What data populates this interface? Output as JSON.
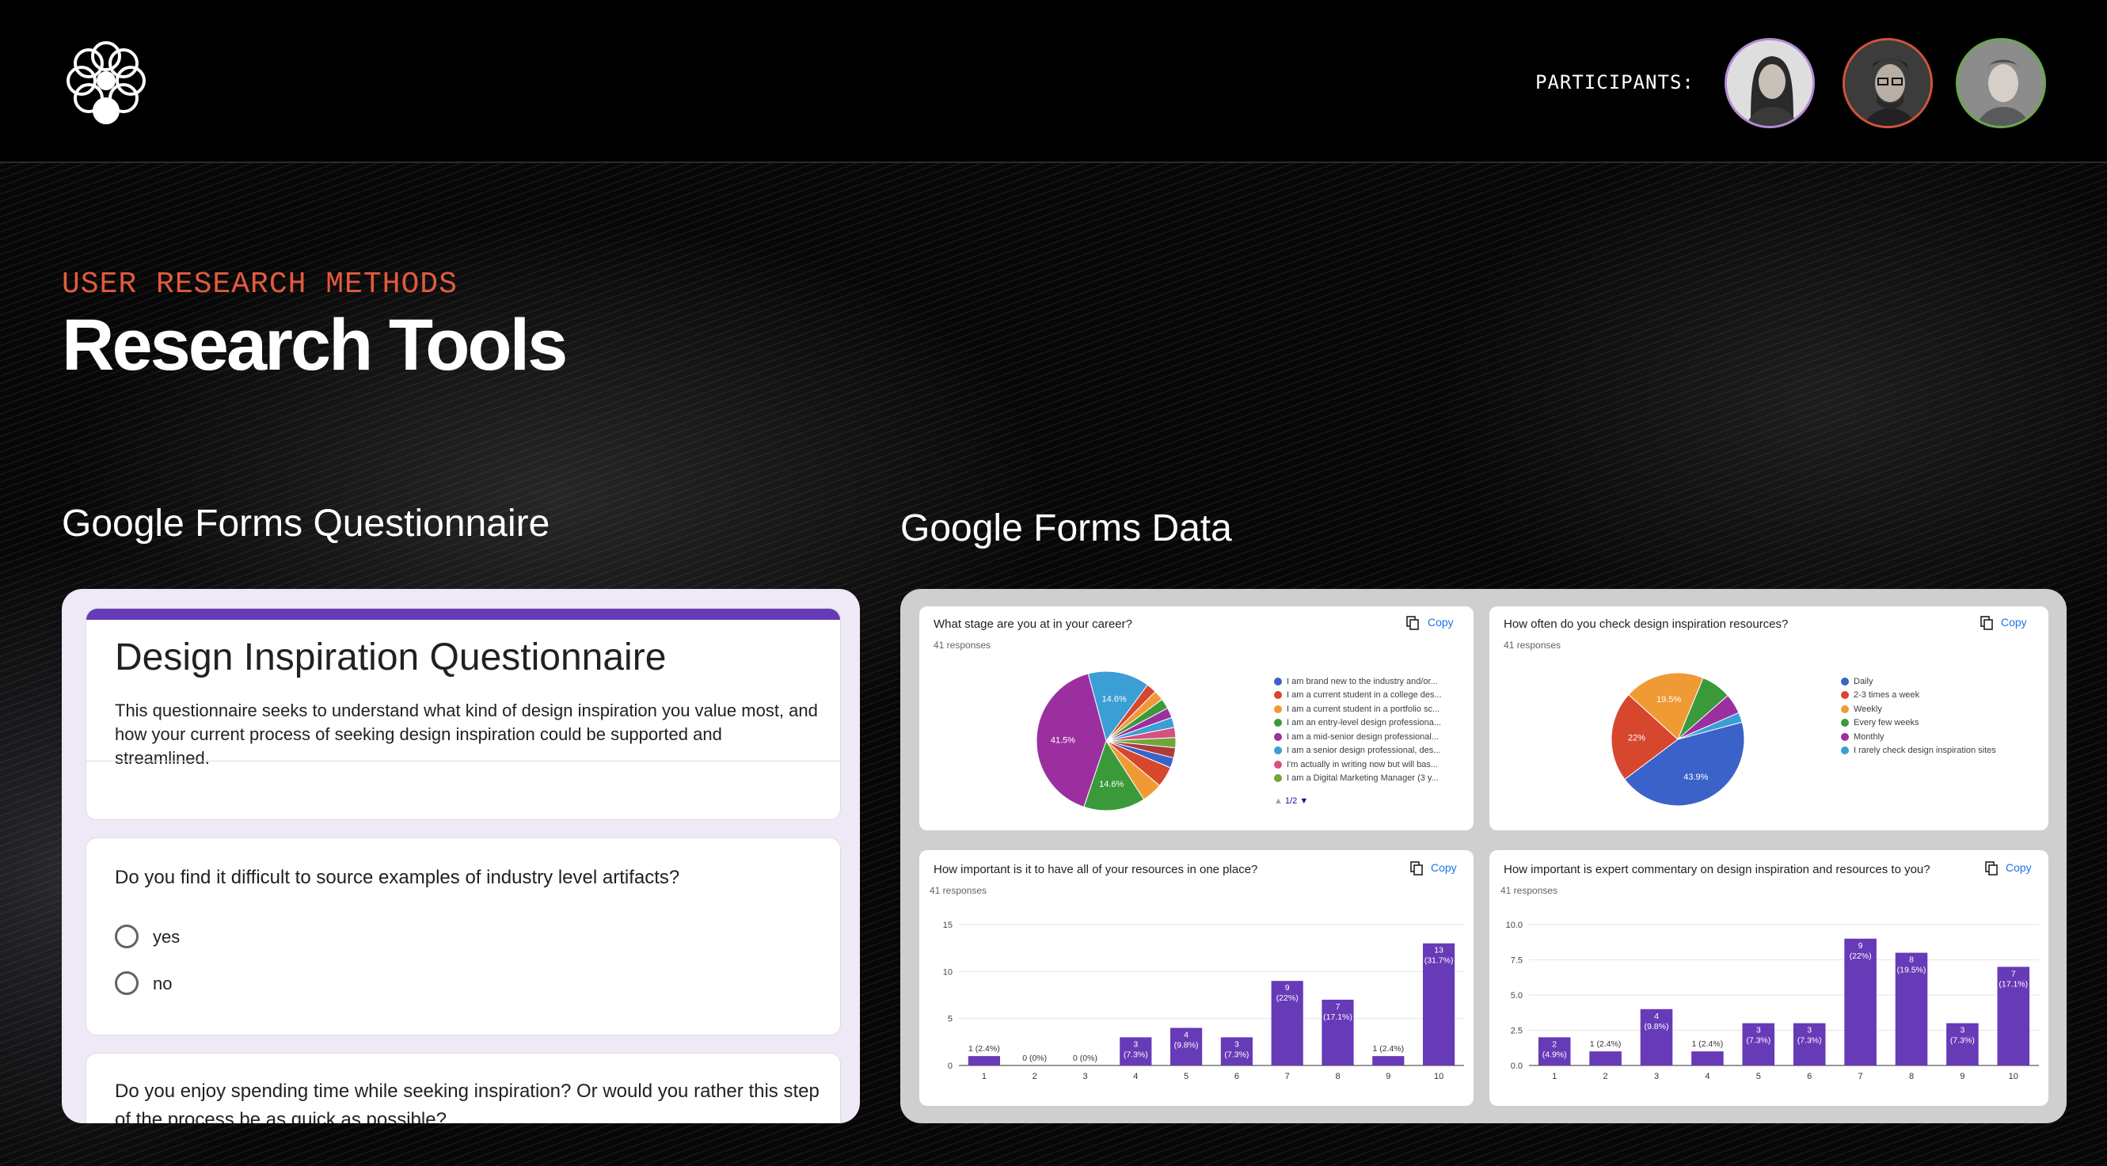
{
  "header": {
    "participants_label": "PARTICIPANTS:",
    "avatars": [
      {
        "name": "participant-1",
        "ring": "#b48ad6"
      },
      {
        "name": "participant-2",
        "ring": "#d0553a"
      },
      {
        "name": "participant-3",
        "ring": "#6aa84f"
      }
    ]
  },
  "hero": {
    "eyebrow": "USER RESEARCH METHODS",
    "title": "Research Tools"
  },
  "sections": {
    "left_title": "Google Forms Questionnaire",
    "right_title": "Google Forms Data"
  },
  "form": {
    "title": "Design Inspiration Questionnaire",
    "description": "This questionnaire seeks to understand what kind of design inspiration you value most, and how your current process of seeking design inspiration could be supported and streamlined.",
    "question1": "Do you find it difficult to source examples of industry level artifacts?",
    "option_yes": "yes",
    "option_no": "no",
    "question2": "Do you enjoy spending time while seeking inspiration? Or would you rather this step of the process be as quick as possible?"
  },
  "copy_label": "Copy",
  "chart_data": [
    {
      "type": "pie",
      "title": "What stage are you at in your career?",
      "responses": "41 responses",
      "legend": [
        "I am brand new to the industry and/or...",
        "I am a current student in a college des...",
        "I am a current student in a portfolio sc...",
        "I am an entry-level design professiona...",
        "I am a mid-senior design professional...",
        "I am a senior design professional, des...",
        "I'm actually in writing now but will bas...",
        "I am a Digital Marketing Manager (3 y..."
      ],
      "pager": "1/2",
      "slices": [
        {
          "label": "14.6%",
          "value": 14.6,
          "color": "#3b9ed5"
        },
        {
          "label": "",
          "value": 2.4,
          "color": "#d6472e"
        },
        {
          "label": "",
          "value": 2.4,
          "color": "#f09a36"
        },
        {
          "label": "",
          "value": 2.4,
          "color": "#3a9a3a"
        },
        {
          "label": "",
          "value": 2.4,
          "color": "#9c2fa0"
        },
        {
          "label": "",
          "value": 2.4,
          "color": "#3b9ed5"
        },
        {
          "label": "",
          "value": 2.4,
          "color": "#d64f7e"
        },
        {
          "label": "",
          "value": 2.4,
          "color": "#6ea83a"
        },
        {
          "label": "",
          "value": 2.4,
          "color": "#b03b3b"
        },
        {
          "label": "",
          "value": 2.4,
          "color": "#3b62c8"
        },
        {
          "label": "",
          "value": 4.9,
          "color": "#d6472e"
        },
        {
          "label": "",
          "value": 4.9,
          "color": "#f09a36"
        },
        {
          "label": "14.6%",
          "value": 14.6,
          "color": "#3a9a3a"
        },
        {
          "label": "41.5%",
          "value": 41.5,
          "color": "#9c2fa0"
        }
      ]
    },
    {
      "type": "pie",
      "title": "How often do you check design inspiration resources?",
      "responses": "41 responses",
      "legend": [
        "Daily",
        "2-3 times a week",
        "Weekly",
        "Every few weeks",
        "Monthly",
        "I rarely check design inspiration sites"
      ],
      "slices": [
        {
          "label": "43.9%",
          "value": 43.9,
          "color": "#3b62c8"
        },
        {
          "label": "22%",
          "value": 22,
          "color": "#d6472e"
        },
        {
          "label": "19.5%",
          "value": 19.5,
          "color": "#f09a36"
        },
        {
          "label": "",
          "value": 7.3,
          "color": "#3a9a3a"
        },
        {
          "label": "",
          "value": 4.9,
          "color": "#9c2fa0"
        },
        {
          "label": "",
          "value": 2.4,
          "color": "#3b9ed5"
        }
      ]
    },
    {
      "type": "bar",
      "title": "How important is it to have all of your resources in one place?",
      "responses": "41 responses",
      "categories": [
        "1",
        "2",
        "3",
        "4",
        "5",
        "6",
        "7",
        "8",
        "9",
        "10"
      ],
      "values": [
        1,
        0,
        0,
        3,
        4,
        3,
        9,
        7,
        1,
        13
      ],
      "labels": [
        "1 (2.4%)",
        "0 (0%)",
        "0 (0%)",
        "3 (7.3%)",
        "4 (9.8%)",
        "3 (7.3%)",
        "9 (22%)",
        "7 (17.1%)",
        "1 (2.4%)",
        "13 (31.7%)"
      ],
      "yticks": [
        "0",
        "5",
        "10",
        "15"
      ],
      "ylim": [
        0,
        15
      ],
      "color": "#673ab7"
    },
    {
      "type": "bar",
      "title": "How important is expert commentary on design inspiration and resources to you?",
      "responses": "41 responses",
      "categories": [
        "1",
        "2",
        "3",
        "4",
        "5",
        "6",
        "7",
        "8",
        "9",
        "10"
      ],
      "values": [
        2,
        1,
        4,
        1,
        3,
        3,
        9,
        8,
        3,
        7
      ],
      "labels": [
        "2 (4.9%)",
        "1 (2.4%)",
        "4 (9.8%)",
        "1 (2.4%)",
        "3 (7.3%)",
        "3 (7.3%)",
        "9 (22%)",
        "8 (19.5%)",
        "3 (7.3%)",
        "7 (17.1%)"
      ],
      "yticks": [
        "0.0",
        "2.5",
        "5.0",
        "7.5",
        "10.0"
      ],
      "ylim": [
        0,
        10
      ],
      "color": "#673ab7"
    }
  ]
}
